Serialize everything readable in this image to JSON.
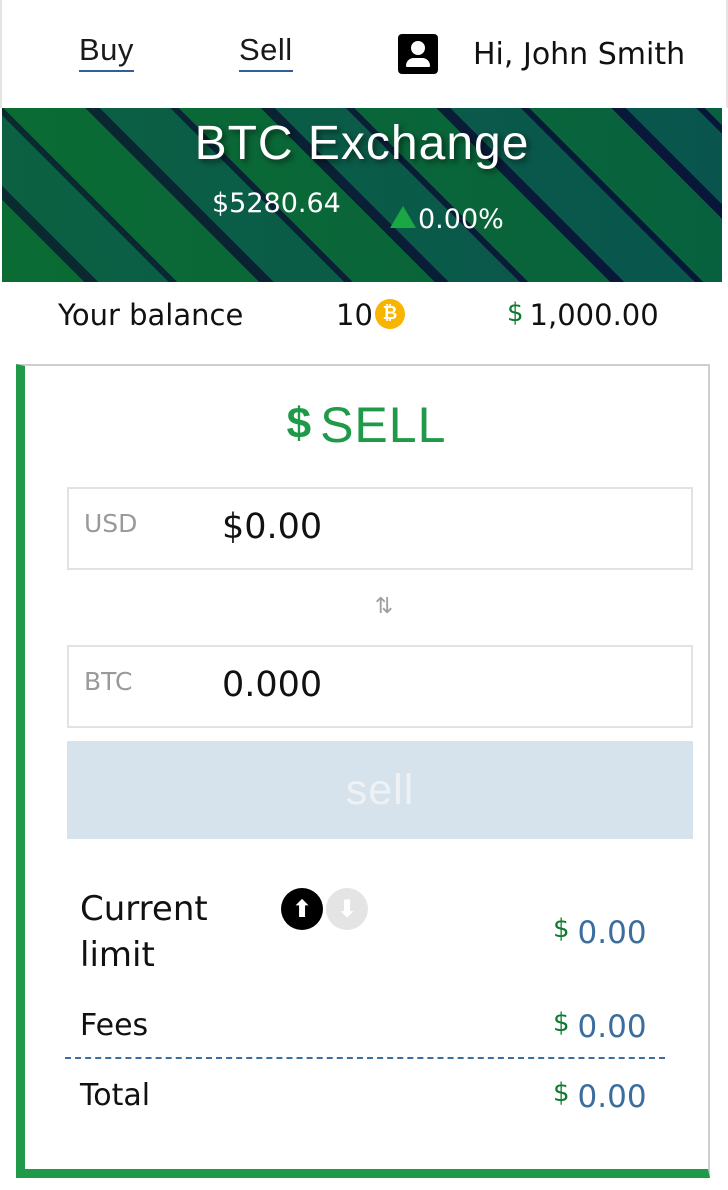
{
  "nav": {
    "buy_label": "Buy",
    "sell_label": "Sell",
    "greeting": "Hi, John Smith"
  },
  "banner": {
    "title": "BTC Exchange",
    "price": "$5280.64",
    "change": "0.00%"
  },
  "balance": {
    "label": "Your balance",
    "btc_amount": "10",
    "btc_icon": "₿",
    "usd_symbol": "$",
    "usd_amount": "1,000.00"
  },
  "sell_card": {
    "title": "SELL",
    "title_icon": "$",
    "usd_field": {
      "label": "USD",
      "value": "$0.00"
    },
    "btc_field": {
      "label": "BTC",
      "value": "0.000"
    },
    "submit_label": "sell",
    "current_limit": {
      "label": "Current limit",
      "symbol": "$",
      "value": "0.00"
    },
    "fees": {
      "label": "Fees",
      "symbol": "$",
      "value": "0.00"
    },
    "total": {
      "label": "Total",
      "symbol": "$",
      "value": "0.00"
    }
  },
  "colors": {
    "accent_green": "#1f9a48",
    "dollar_green": "#0f7a2e",
    "value_blue": "#3b6e9e",
    "button_disabled": "#d6e2ec"
  }
}
